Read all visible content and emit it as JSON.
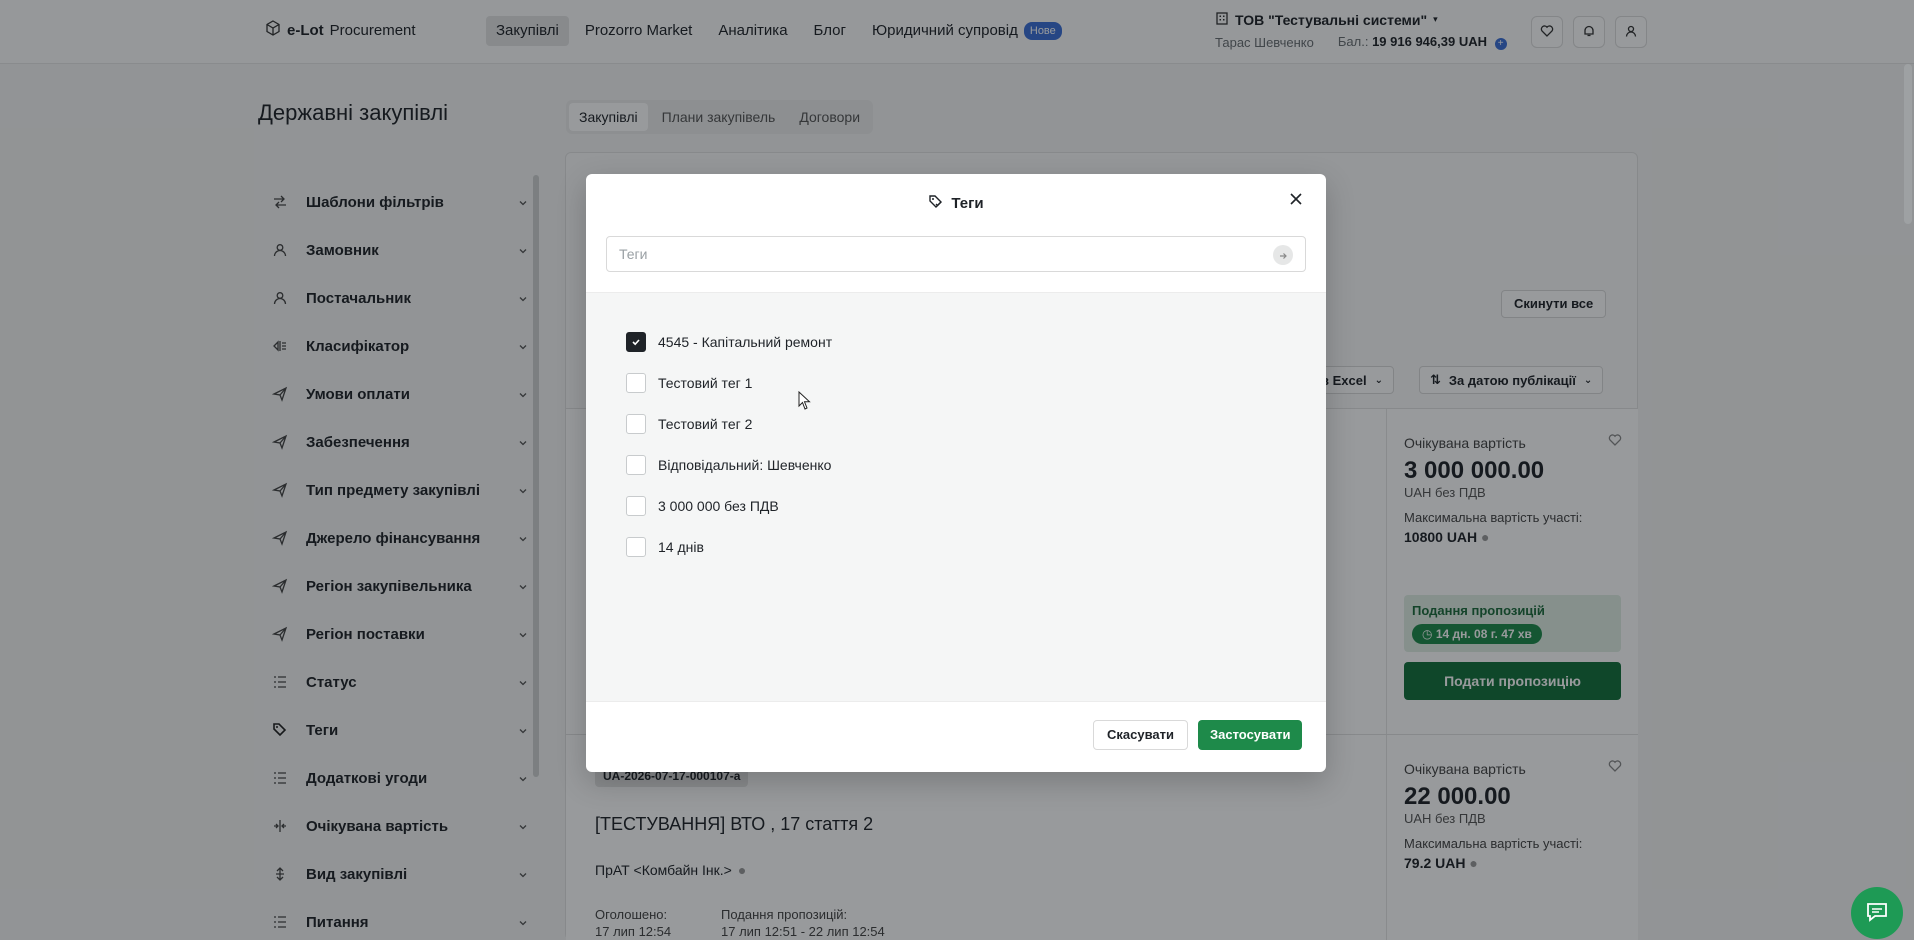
{
  "header": {
    "logo_bold": "e-Lot",
    "logo_text": "Procurement",
    "nav": [
      {
        "label": "Закупівлі"
      },
      {
        "label": "Prozorro Market"
      },
      {
        "label": "Аналітика"
      },
      {
        "label": "Блог"
      },
      {
        "label": "Юридичний супровід",
        "badge": "Нове"
      }
    ],
    "org": "ТОВ \"Тестувальні системи\"",
    "user": "Тарас Шевченко",
    "balance_label": "Бал.:",
    "balance_value": "19 916 946,39 UAH"
  },
  "page": {
    "title": "Державні закупівлі",
    "tabs": [
      "Закупівлі",
      "Плани закупівель",
      "Договори"
    ],
    "reset_label": "Скинути все",
    "excel_label": "в Excel",
    "sort_label": "За датою публікації"
  },
  "sidebar": {
    "items": [
      {
        "label": "Шаблони фільтрів",
        "icon": "swap-icon"
      },
      {
        "label": "Замовник",
        "icon": "user-icon"
      },
      {
        "label": "Постачальник",
        "icon": "user-icon"
      },
      {
        "label": "Класифікатор",
        "icon": "classifier-icon"
      },
      {
        "label": "Умови оплати",
        "icon": "send-icon"
      },
      {
        "label": "Забезпечення",
        "icon": "send-icon"
      },
      {
        "label": "Тип предмету закупівлі",
        "icon": "send-icon"
      },
      {
        "label": "Джерело фінансування",
        "icon": "send-icon"
      },
      {
        "label": "Регіон закупівельника",
        "icon": "send-icon"
      },
      {
        "label": "Регіон поставки",
        "icon": "send-icon"
      },
      {
        "label": "Статус",
        "icon": "list-icon"
      },
      {
        "label": "Теги",
        "icon": "tag-icon"
      },
      {
        "label": "Додаткові угоди",
        "icon": "list-icon"
      },
      {
        "label": "Очікувана вартість",
        "icon": "range-icon"
      },
      {
        "label": "Вид закупівлі",
        "icon": "sort-icon"
      },
      {
        "label": "Питання",
        "icon": "list-icon"
      }
    ]
  },
  "cards": [
    {
      "expected_label": "Очікувана вартість",
      "value": "3 000 000.00",
      "currency": "UAH без ПДВ",
      "max_label": "Максимальна вартість участі:",
      "max_value": "10800 UAH",
      "bid_title": "Подання пропозицій",
      "countdown": "14 дн. 08 г. 47 хв",
      "bid_button": "Подати пропозицію"
    },
    {
      "expected_label": "Очікувана вартість",
      "value": "22 000.00",
      "currency": "UAH без ПДВ",
      "max_label": "Максимальна вартість участі:",
      "max_value": "79.2 UAH"
    }
  ],
  "tender": {
    "id": "UA-2026-07-17-000107-a",
    "title": "[ТЕСТУВАННЯ] ВТО , 17 стаття 2",
    "org": "ПрАТ <Комбайн Інк.>",
    "announced_label": "Оголошено:",
    "announced_value": "17 лип 12:54",
    "bids_label": "Подання пропозицій:",
    "bids_value": "17 лип 12:51 - 22 лип 12:54"
  },
  "modal": {
    "title": "Теги",
    "search_placeholder": "Теги",
    "options": [
      {
        "label": "4545 - Капітальний ремонт",
        "checked": true
      },
      {
        "label": "Тестовий тег 1",
        "checked": false
      },
      {
        "label": "Тестовий тег 2",
        "checked": false
      },
      {
        "label": "Відповідальний: Шевченко",
        "checked": false
      },
      {
        "label": "3 000 000 без ПДВ",
        "checked": false
      },
      {
        "label": "14 днів",
        "checked": false
      }
    ],
    "cancel_label": "Скасувати",
    "apply_label": "Застосувати"
  },
  "colors": {
    "primary_green": "#1e8a4a",
    "badge_blue": "#3b6fd6"
  }
}
